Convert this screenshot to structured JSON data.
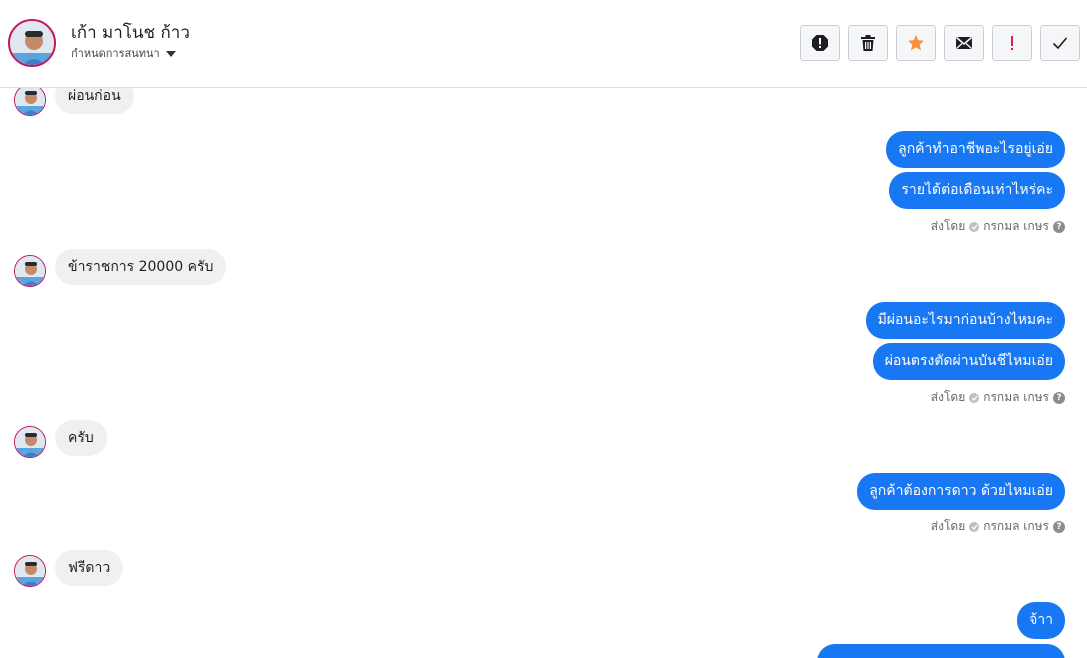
{
  "header": {
    "contact_name": "เก้า มาโนช ก้าว",
    "assign_label": "กำหนดการสนทนา",
    "actions": [
      {
        "icon": "alert-circle-icon"
      },
      {
        "icon": "trash-icon"
      },
      {
        "icon": "star-icon",
        "color": "#f7923a"
      },
      {
        "icon": "envelope-icon"
      },
      {
        "icon": "exclamation-icon",
        "color": "#e41e3f"
      },
      {
        "icon": "checkmark-icon"
      }
    ]
  },
  "messages": {
    "in_1": "ผ่อนก่อน",
    "out_1a": "ลูกค้าทำอาชีพอะไรอยู่เอ่ย",
    "out_1b": "รายได้ต่อเดือนเท่าไหร่คะ",
    "in_2": "ข้าราชการ 20000 ครับ",
    "out_2a": "มีผ่อนอะไรมาก่อนบ้างไหมคะ",
    "out_2b": "ผ่อนตรงตัดผ่านบันชีไหมเอ่ย",
    "in_3": "ครับ",
    "out_3a": "ลูกค้าต้องการดาว ด้วยไหมเอ่ย",
    "in_4": "ฟรีดาว",
    "out_4a": "จ้าา"
  },
  "sent_by": {
    "prefix": "ส่งโดย",
    "agent": "กรกมล เกษร"
  },
  "colors": {
    "outgoing_bubble": "#1877f2",
    "incoming_bubble": "#f0f0f0",
    "avatar_ring": "#c2185b"
  }
}
